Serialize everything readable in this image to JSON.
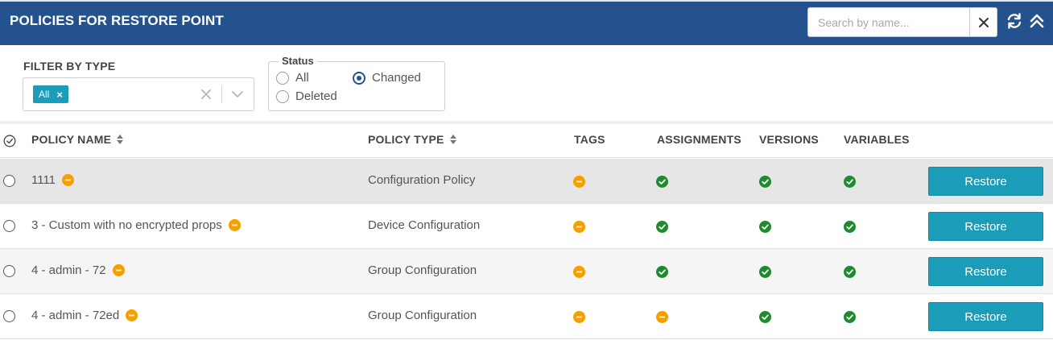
{
  "header": {
    "title": "POLICIES FOR RESTORE POINT",
    "search_placeholder": "Search by name...",
    "search_value": ""
  },
  "filters": {
    "type_label": "FILTER BY TYPE",
    "type_chip": "All",
    "status_legend": "Status",
    "status_options": [
      {
        "label": "All",
        "checked": false
      },
      {
        "label": "Changed",
        "checked": true
      },
      {
        "label": "Deleted",
        "checked": false
      }
    ]
  },
  "table": {
    "columns": [
      "POLICY NAME",
      "POLICY TYPE",
      "TAGS",
      "ASSIGNMENTS",
      "VERSIONS",
      "VARIABLES"
    ],
    "restore_label": "Restore",
    "rows": [
      {
        "name": "1111",
        "type": "Configuration Policy",
        "tags": "changed",
        "assignments": "ok",
        "versions": "ok",
        "variables": "ok"
      },
      {
        "name": "3 - Custom with no encrypted props",
        "type": "Device Configuration",
        "tags": "changed",
        "assignments": "ok",
        "versions": "ok",
        "variables": "ok"
      },
      {
        "name": "4 - admin - 72",
        "type": "Group Configuration",
        "tags": "changed",
        "assignments": "ok",
        "versions": "ok",
        "variables": "ok"
      },
      {
        "name": "4 - admin - 72ed",
        "type": "Group Configuration",
        "tags": "changed",
        "assignments": "changed",
        "versions": "ok",
        "variables": "ok"
      }
    ]
  },
  "colors": {
    "header_bg": "#24528f",
    "accent": "#1b9cb8",
    "status_ok": "#1f8a2e",
    "status_changed": "#f5a000"
  },
  "icons": {
    "search_clear": "close-icon",
    "refresh": "refresh-icon",
    "collapse": "chevron-double-up-icon",
    "select_all": "check-circle-icon",
    "sort": "sort-icon",
    "status_ok": "check-circle-icon",
    "status_changed": "minus-circle-icon"
  }
}
